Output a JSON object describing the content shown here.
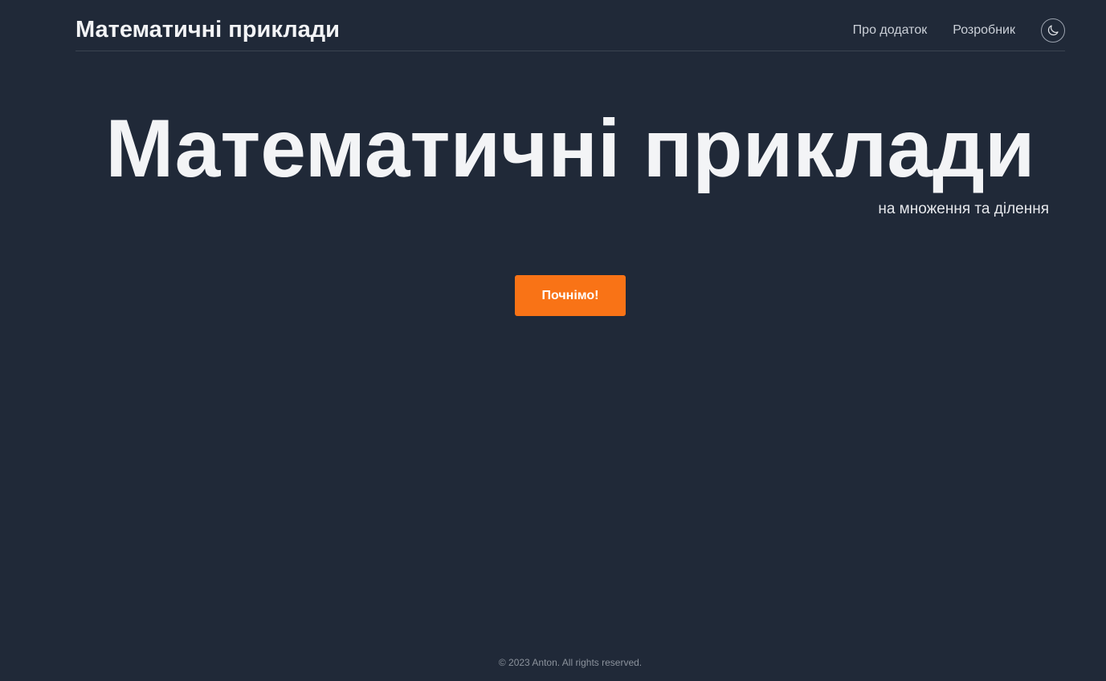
{
  "header": {
    "brand": "Математичні приклади",
    "nav": [
      {
        "label": "Про додаток"
      },
      {
        "label": "Розробник"
      }
    ],
    "theme_toggle_icon": "moon-icon"
  },
  "hero": {
    "title": "Математичні приклади",
    "subtitle": "на множення та ділення",
    "cta_label": "Почнімо!"
  },
  "footer": {
    "copyright": "© 2023 Anton. All rights reserved."
  },
  "colors": {
    "background": "#202938",
    "text": "#f3f4f6",
    "accent": "#f97316"
  }
}
